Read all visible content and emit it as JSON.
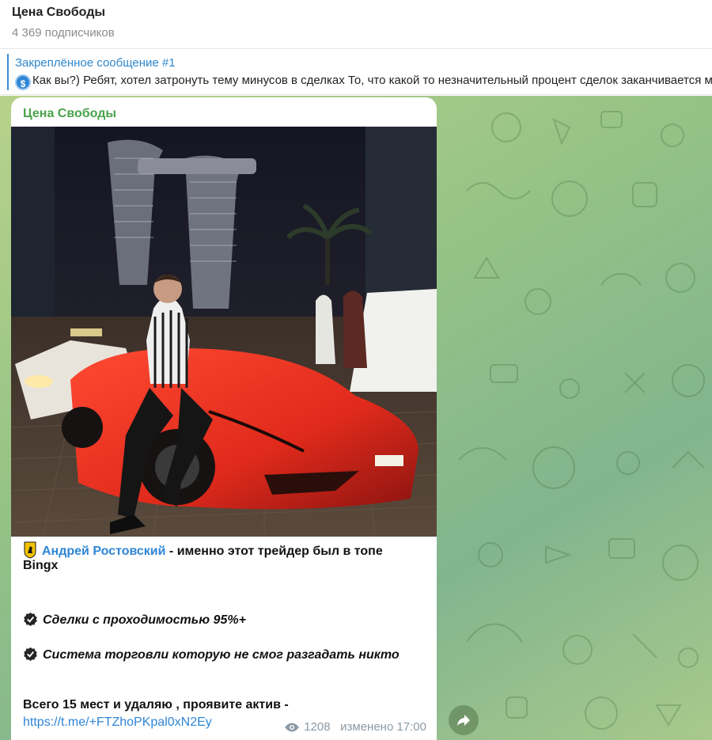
{
  "channel": {
    "title": "Цена Свободы",
    "subscribers": "4 369 подписчиков"
  },
  "pinned": {
    "title": "Закреплённое сообщение #1",
    "coin_icon": "$",
    "text": "Как вы?)  Ребят, хотел затронуть тему минусов в сделках  То, что какой то незначительный процент сделок заканчивается минусом"
  },
  "post": {
    "channel_name": "Цена Свободы",
    "image_icon": "photo-man-red-sportscar-night-city",
    "author_link": "Андрей Ростовский",
    "author_rest": " - именно этот трейдер был в топе",
    "author_rest2": "Bingx",
    "point1": "Сделки с проходимостью 95%+",
    "point2": "Система торговли которую не смог разгадать никто",
    "cta": "Всего 15 мест и удаляю , проявите актив -",
    "link": "https://t.me/+FTZhoPKpal0xN2Ey",
    "views": "1208",
    "edited": "изменено 17:00"
  },
  "colors": {
    "accent_blue": "#2f86d6",
    "channel_green": "#4aa34b",
    "chat_bg": "#94c286"
  }
}
